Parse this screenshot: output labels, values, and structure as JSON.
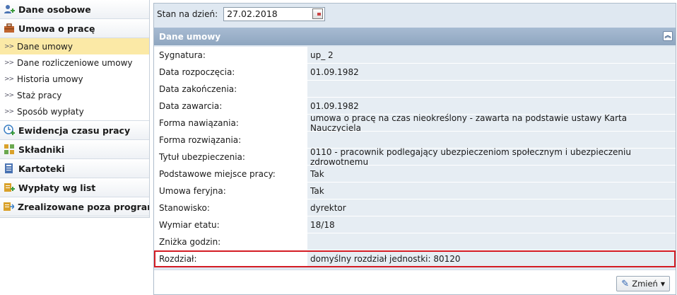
{
  "sidebar": {
    "sections": [
      {
        "label": "Dane osobowe",
        "icon": "person-add-icon"
      },
      {
        "label": "Umowa o pracę",
        "icon": "briefcase-icon"
      }
    ],
    "subitems": [
      {
        "label": "Dane umowy",
        "active": true
      },
      {
        "label": "Dane rozliczeniowe umowy"
      },
      {
        "label": "Historia umowy"
      },
      {
        "label": "Staż pracy"
      },
      {
        "label": "Sposób wypłaty"
      }
    ],
    "sections2": [
      {
        "label": "Ewidencja czasu pracy",
        "icon": "clock-add-icon"
      },
      {
        "label": "Składniki",
        "icon": "components-icon"
      },
      {
        "label": "Kartoteki",
        "icon": "cards-icon"
      },
      {
        "label": "Wypłaty wg list",
        "icon": "payments-list-icon"
      },
      {
        "label": "Zrealizowane poza programem",
        "icon": "external-payments-icon"
      }
    ]
  },
  "stan": {
    "label": "Stan na dzień:",
    "value": "27.02.2018"
  },
  "section": {
    "title": "Dane umowy"
  },
  "rows": [
    {
      "label": "Sygnatura:",
      "value": "up_ 2"
    },
    {
      "label": "Data rozpoczęcia:",
      "value": "01.09.1982"
    },
    {
      "label": "Data zakończenia:",
      "value": ""
    },
    {
      "label": "Data zawarcia:",
      "value": "01.09.1982"
    },
    {
      "label": "Forma nawiązania:",
      "value": "umowa o pracę na czas nieokreślony - zawarta na podstawie ustawy Karta Nauczyciela"
    },
    {
      "label": "Forma rozwiązania:",
      "value": ""
    },
    {
      "label": "Tytuł ubezpieczenia:",
      "value": "0110 - pracownik podlegający ubezpieczeniom społecznym i ubezpieczeniu zdrowotnemu"
    },
    {
      "label": "Podstawowe miejsce pracy:",
      "value": "Tak"
    },
    {
      "label": "Umowa feryjna:",
      "value": "Tak"
    },
    {
      "label": "Stanowisko:",
      "value": "dyrektor"
    },
    {
      "label": "Wymiar etatu:",
      "value": "18/18"
    },
    {
      "label": "Zniżka godzin:",
      "value": ""
    },
    {
      "label": "Rozdział:",
      "value": "domyślny rozdział jednostki: 80120"
    }
  ],
  "footer": {
    "zmien_label": "Zmień"
  },
  "colors": {
    "highlight_border": "#d41c24",
    "section_header": "#97aec7",
    "active_item": "#fbe9a6",
    "value_bg": "#e6edf3"
  }
}
